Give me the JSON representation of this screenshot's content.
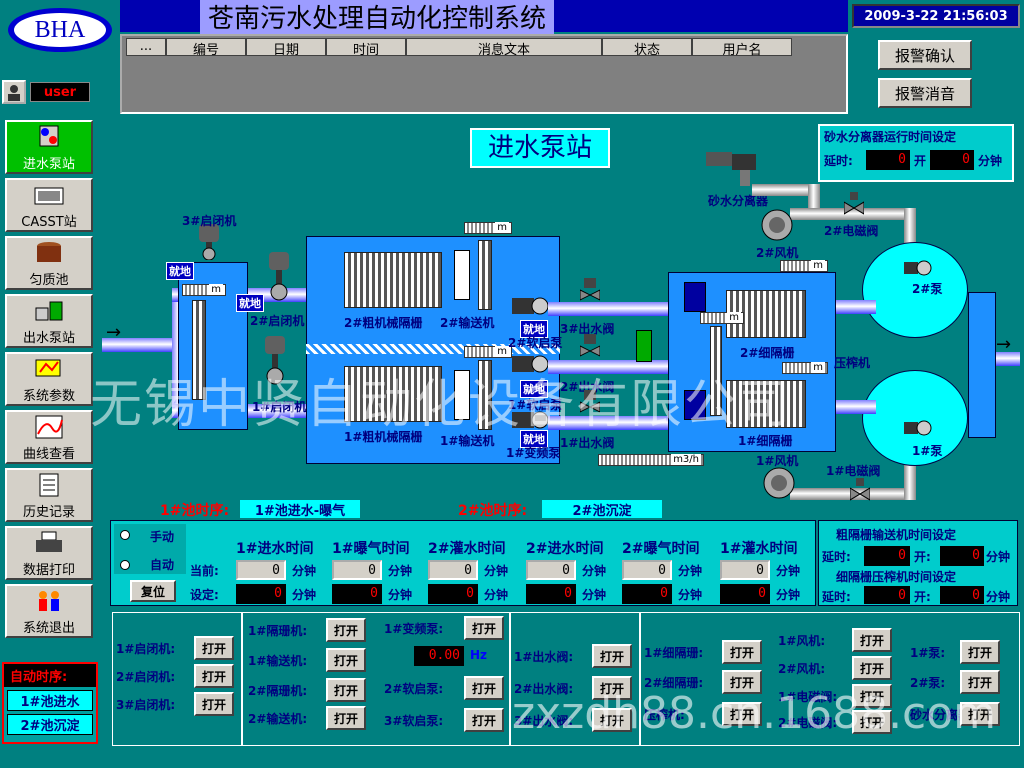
{
  "header": {
    "logo": "BHA",
    "title": "苍南污水处理自动化控制系统",
    "datetime": "2009-3-22 21:56:03",
    "user": "user"
  },
  "alarm_table": {
    "columns": [
      "...",
      "编号",
      "日期",
      "时间",
      "消息文本",
      "状态",
      "用户名"
    ]
  },
  "alarm_buttons": {
    "confirm": "报警确认",
    "silence": "报警消音"
  },
  "nav": [
    {
      "label": "进水泵站",
      "icon": "pump-station-icon"
    },
    {
      "label": "CASST站",
      "icon": "casst-icon"
    },
    {
      "label": "匀质池",
      "icon": "tank-icon"
    },
    {
      "label": "出水泵站",
      "icon": "outlet-pump-icon"
    },
    {
      "label": "系统参数",
      "icon": "parameters-icon"
    },
    {
      "label": "曲线查看",
      "icon": "curve-icon"
    },
    {
      "label": "历史记录",
      "icon": "history-icon"
    },
    {
      "label": "数据打印",
      "icon": "printer-icon"
    },
    {
      "label": "系统退出",
      "icon": "exit-icon"
    }
  ],
  "auto_seq": {
    "title": "自动时序:",
    "items": [
      "1#池进水",
      "2#池沉淀"
    ]
  },
  "page_title": "进水泵站",
  "sand_timer": {
    "title": "砂水分离器运行时间设定",
    "delay": "延时:",
    "open": "开",
    "unit": "分钟",
    "delay_val": "0",
    "open_val": "0"
  },
  "diagram": {
    "gate3": "3#启闭机",
    "gate2": "2#启闭机",
    "gate1": "1#启闭机",
    "screen2": "2#粗机械隔栅",
    "screen1": "1#粗机械隔栅",
    "conv2": "2#输送机",
    "conv1": "1#输送机",
    "soft2": "2#软启泵",
    "soft1": "1#软启泵",
    "vfd1": "1#变频泵",
    "valve3": "3#出水阀",
    "valve2": "2#出水阀",
    "valve1": "1#出水阀",
    "fine2": "2#细隔栅",
    "fine1": "1#细隔栅",
    "press": "压榨机",
    "fan2": "2#风机",
    "fan1": "1#风机",
    "sol2": "2#电磁阀",
    "sol1": "1#电磁阀",
    "pump2": "2#泵",
    "pump1": "1#泵",
    "sand_sep": "砂水分离器",
    "local": "就地",
    "unit_m": "m",
    "unit_flow": "m3/h",
    "level_val": "0.00"
  },
  "pool_timing": {
    "label1": "1#池时序:",
    "value1": "1#池进水-曝气",
    "label2": "2#池时序:",
    "value2": "2#池沉淀"
  },
  "timing_panel": {
    "manual": "手动",
    "auto": "自动",
    "reset": "复位",
    "current": "当前:",
    "set": "设定:",
    "unit": "分钟",
    "columns": [
      "1#进水时间",
      "1#曝气时间",
      "2#灌水时间",
      "2#进水时间",
      "2#曝气时间",
      "1#灌水时间"
    ],
    "current_vals": [
      "0",
      "0",
      "0",
      "0",
      "0",
      "0"
    ],
    "set_vals": [
      "0",
      "0",
      "0",
      "0",
      "0",
      "0"
    ]
  },
  "screen_timer": {
    "title1": "粗隔栅输送机时间设定",
    "title2": "细隔栅压榨机时间设定",
    "delay": "延时:",
    "open": "开:",
    "unit": "分钟",
    "vals": [
      "0",
      "0",
      "0",
      "0"
    ]
  },
  "controls": {
    "open": "打开",
    "group1": [
      "1#启闭机:",
      "2#启闭机:",
      "3#启闭机:"
    ],
    "group2": [
      "1#隔珊机:",
      "1#输送机:",
      "2#隔珊机:",
      "2#输送机:"
    ],
    "group3": [
      "1#变频泵:",
      "2#软启泵:",
      "3#软启泵:"
    ],
    "vfd_val": "0.00",
    "vfd_unit": "Hz",
    "group4": [
      "1#出水阀:",
      "2#出水阀:",
      "3#出水阀:"
    ],
    "group5": [
      "1#细隔珊:",
      "2#细隔珊:",
      "压榨机:"
    ],
    "group6": [
      "1#风机:",
      "2#风机:",
      "1#电磁阀:",
      "2#电磁阀:"
    ],
    "group7": [
      "1#泵:",
      "2#泵:",
      "砂水分离器:"
    ]
  },
  "watermarks": {
    "company": "无锡中贤自动化设备有限公司",
    "site": "zxzdh88.cn.1688.com"
  }
}
